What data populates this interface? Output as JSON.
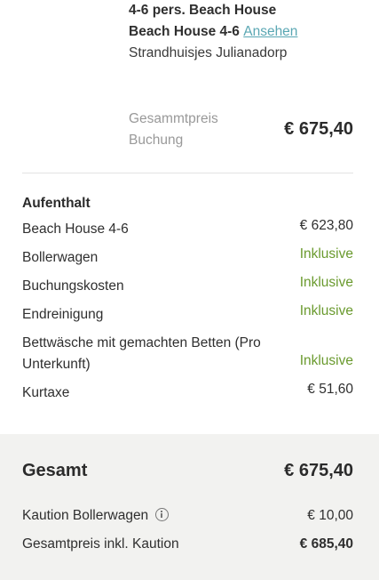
{
  "property": {
    "line1": "4-6 pers. Beach House",
    "line2": "Beach House 4-6",
    "link_label": "Ansehen",
    "park": "Strandhuisjes Julianadorp"
  },
  "total": {
    "label": "Gesammtpreis Buchung",
    "value": "€ 675,40"
  },
  "stay": {
    "title": "Aufenthalt",
    "items": [
      {
        "label": "Beach House 4-6",
        "value": "€ 623,80",
        "included": false
      },
      {
        "label": "Bollerwagen",
        "value": "Inklusive",
        "included": true
      },
      {
        "label": "Buchungskosten",
        "value": "Inklusive",
        "included": true
      },
      {
        "label": "Endreinigung",
        "value": "Inklusive",
        "included": true
      },
      {
        "label": "Bettwäsche mit gemachten Betten (Pro Unterkunft)",
        "value": "Inklusive",
        "included": true
      },
      {
        "label": "Kurtaxe",
        "value": "€ 51,60",
        "included": false
      }
    ]
  },
  "footer": {
    "grand_label": "Gesamt",
    "grand_value": "€ 675,40",
    "deposit_label": "Kaution Bollerwagen",
    "deposit_info_icon": "info-icon",
    "deposit_value": "€ 10,00",
    "total_incl_label": "Gesamtpreis inkl. Kaution",
    "total_incl_value": "€ 685,40"
  },
  "colors": {
    "link": "#5aa7b3",
    "included": "#6a9a2e",
    "footer_bg": "#f2f2f0",
    "muted": "#999999"
  }
}
